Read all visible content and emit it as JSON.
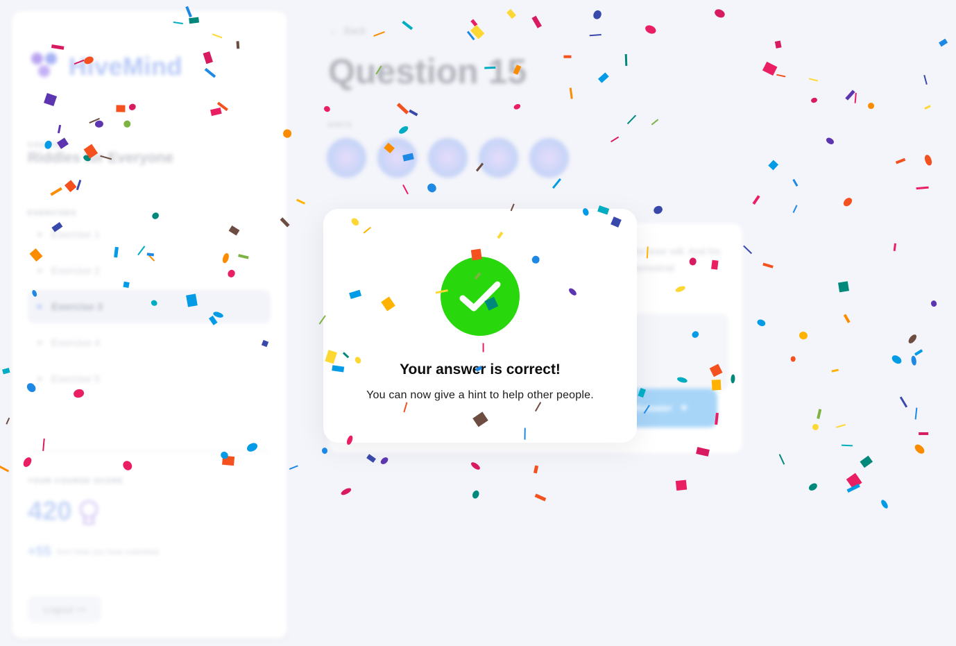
{
  "app": {
    "brand": "HiveMind",
    "course_label": "COURSE",
    "course_name": "Riddles for Everyone",
    "exercises_label": "EXERCISES",
    "exercises": [
      {
        "label": "Exercise 1",
        "active": false
      },
      {
        "label": "Exercise 2",
        "active": false
      },
      {
        "label": "Exercise 3",
        "active": true
      },
      {
        "label": "Exercise 4",
        "active": false
      },
      {
        "label": "Exercise 5",
        "active": false
      }
    ],
    "score_label": "YOUR COURSE SCORE",
    "score": "420",
    "score_delta": "+55",
    "score_delta_text": "from hints you have submitted",
    "logout_label": "Logout"
  },
  "main": {
    "back_label": "Back",
    "question_title": "Question 15",
    "hints_label": "HINTS",
    "riddle_excerpt": "for ever will. And his terrestrial",
    "submit_label": "Answer"
  },
  "modal": {
    "title": "Your answer is correct!",
    "message": "You can now give a hint to help other people.",
    "icon": "check-icon",
    "success_color": "#29d80c"
  },
  "colors": {
    "confetti": [
      "#1e88e5",
      "#3949ab",
      "#5e35b1",
      "#00acc1",
      "#00897b",
      "#7cb342",
      "#fdd835",
      "#fb8c00",
      "#f4511e",
      "#e91e63",
      "#6d4c41",
      "#ffb300",
      "#039be5",
      "#d81b60"
    ]
  }
}
